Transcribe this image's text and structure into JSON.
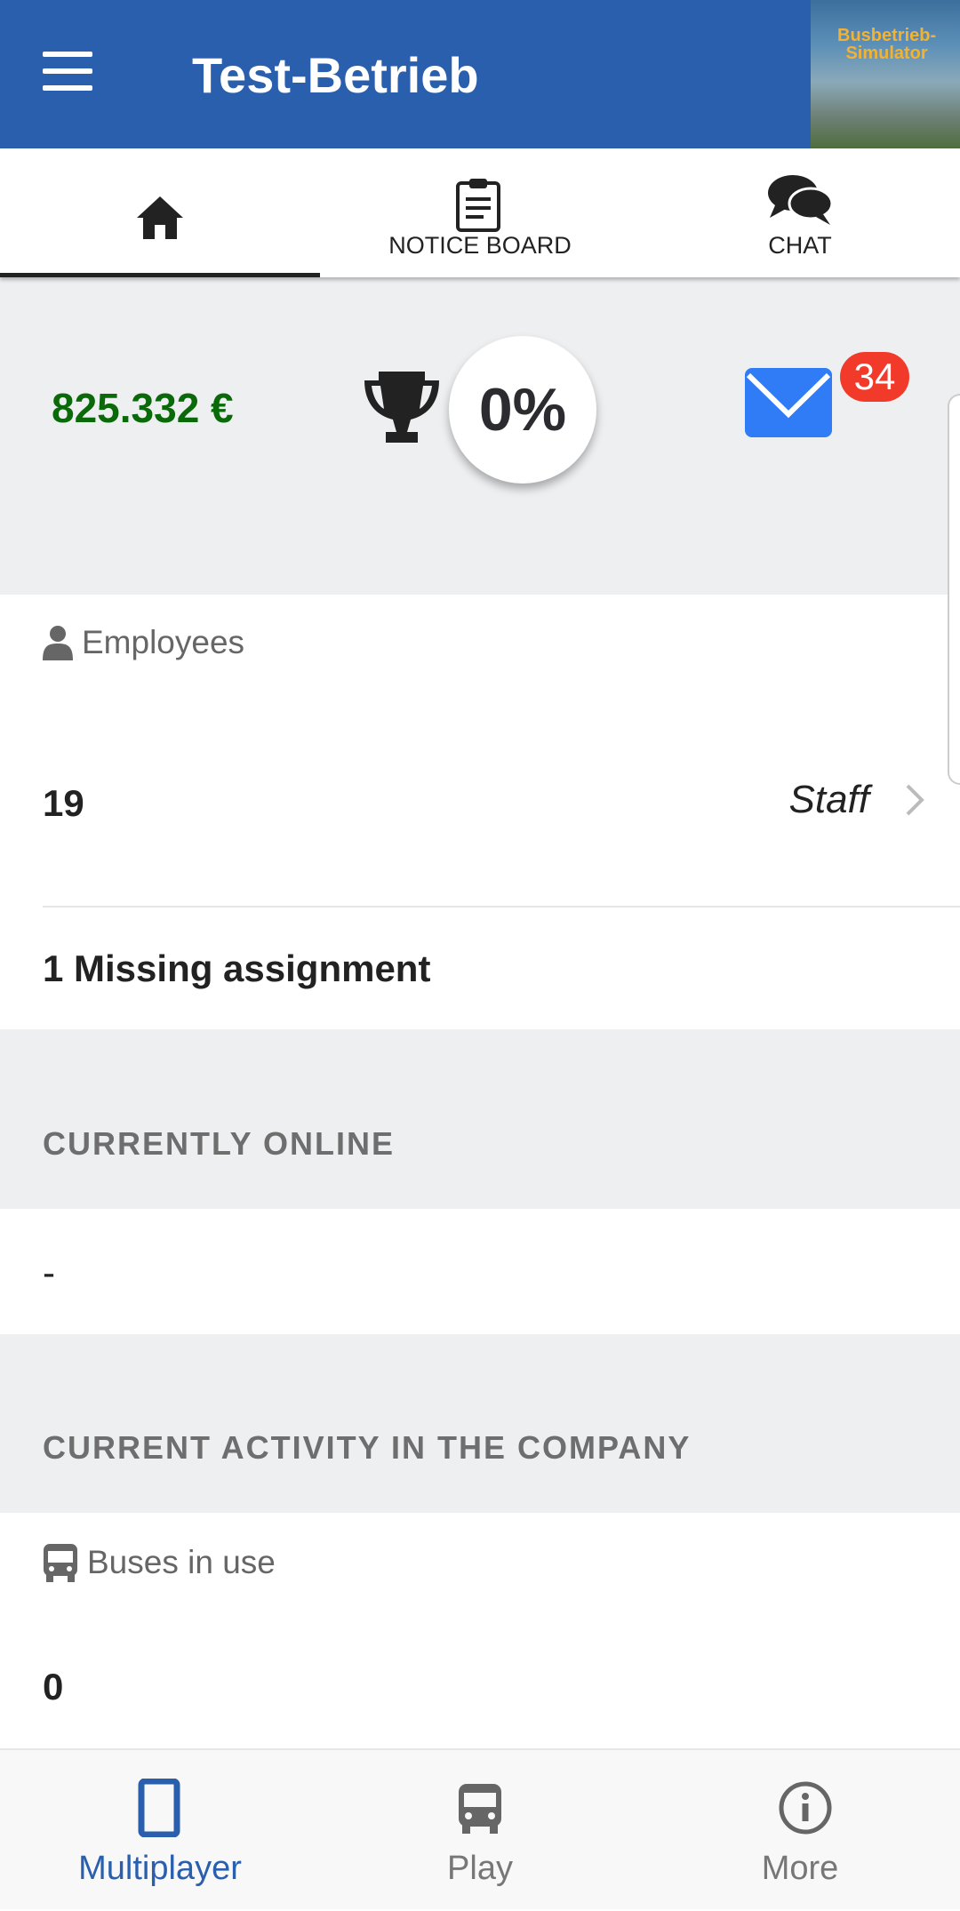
{
  "header": {
    "title": "Test-Betrieb",
    "cover_text": "Busbetrieb-Simulator"
  },
  "tabs": [
    {
      "label": "",
      "icon": "home-icon",
      "active": true
    },
    {
      "label": "NOTICE BOARD",
      "icon": "clipboard-icon"
    },
    {
      "label": "CHAT",
      "icon": "chat-icon"
    }
  ],
  "stats": {
    "money": "825.332 €",
    "progress": "0%",
    "messages_badge": "34"
  },
  "employees": {
    "title": "Employees",
    "count": "19",
    "link": "Staff",
    "missing": "1 Missing assignment"
  },
  "online": {
    "title": "CURRENTLY ONLINE",
    "value": "-"
  },
  "activity": {
    "title": "CURRENT ACTIVITY IN THE COMPANY",
    "buses_title": "Buses in use",
    "buses_value": "0"
  },
  "nav": [
    {
      "label": "Multiplayer",
      "active": true
    },
    {
      "label": "Play"
    },
    {
      "label": "More"
    }
  ],
  "colors": {
    "header": "#2a5fae",
    "money": "#0a6a0a",
    "badge": "#f23a2a",
    "mail": "#2f7cf6",
    "nav_active": "#2a5fae"
  }
}
